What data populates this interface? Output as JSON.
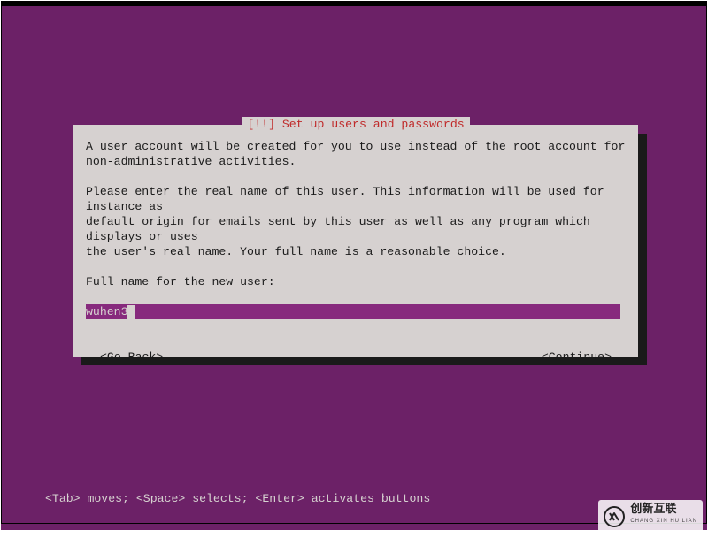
{
  "dialog": {
    "title": "[!!] Set up users and passwords",
    "body": "A user account will be created for you to use instead of the root account for\nnon-administrative activities.\n\nPlease enter the real name of this user. This information will be used for instance as\ndefault origin for emails sent by this user as well as any program which displays or uses\nthe user's real name. Your full name is a reasonable choice.",
    "prompt": "Full name for the new user:",
    "input_value": "wuhen3",
    "go_back": "<Go Back>",
    "continue": "<Continue>"
  },
  "help": "<Tab> moves; <Space> selects; <Enter> activates buttons",
  "watermark": {
    "brand": "创新互联",
    "sub": "CHANG XIN HU LIAN"
  },
  "colors": {
    "background": "#6c2167",
    "dialog_bg": "#d6d1d0",
    "input_bg": "#872a7d",
    "title_fg": "#c02b2b",
    "text_fg": "#1a1a1a",
    "inverse_fg": "#d6d1d0"
  }
}
